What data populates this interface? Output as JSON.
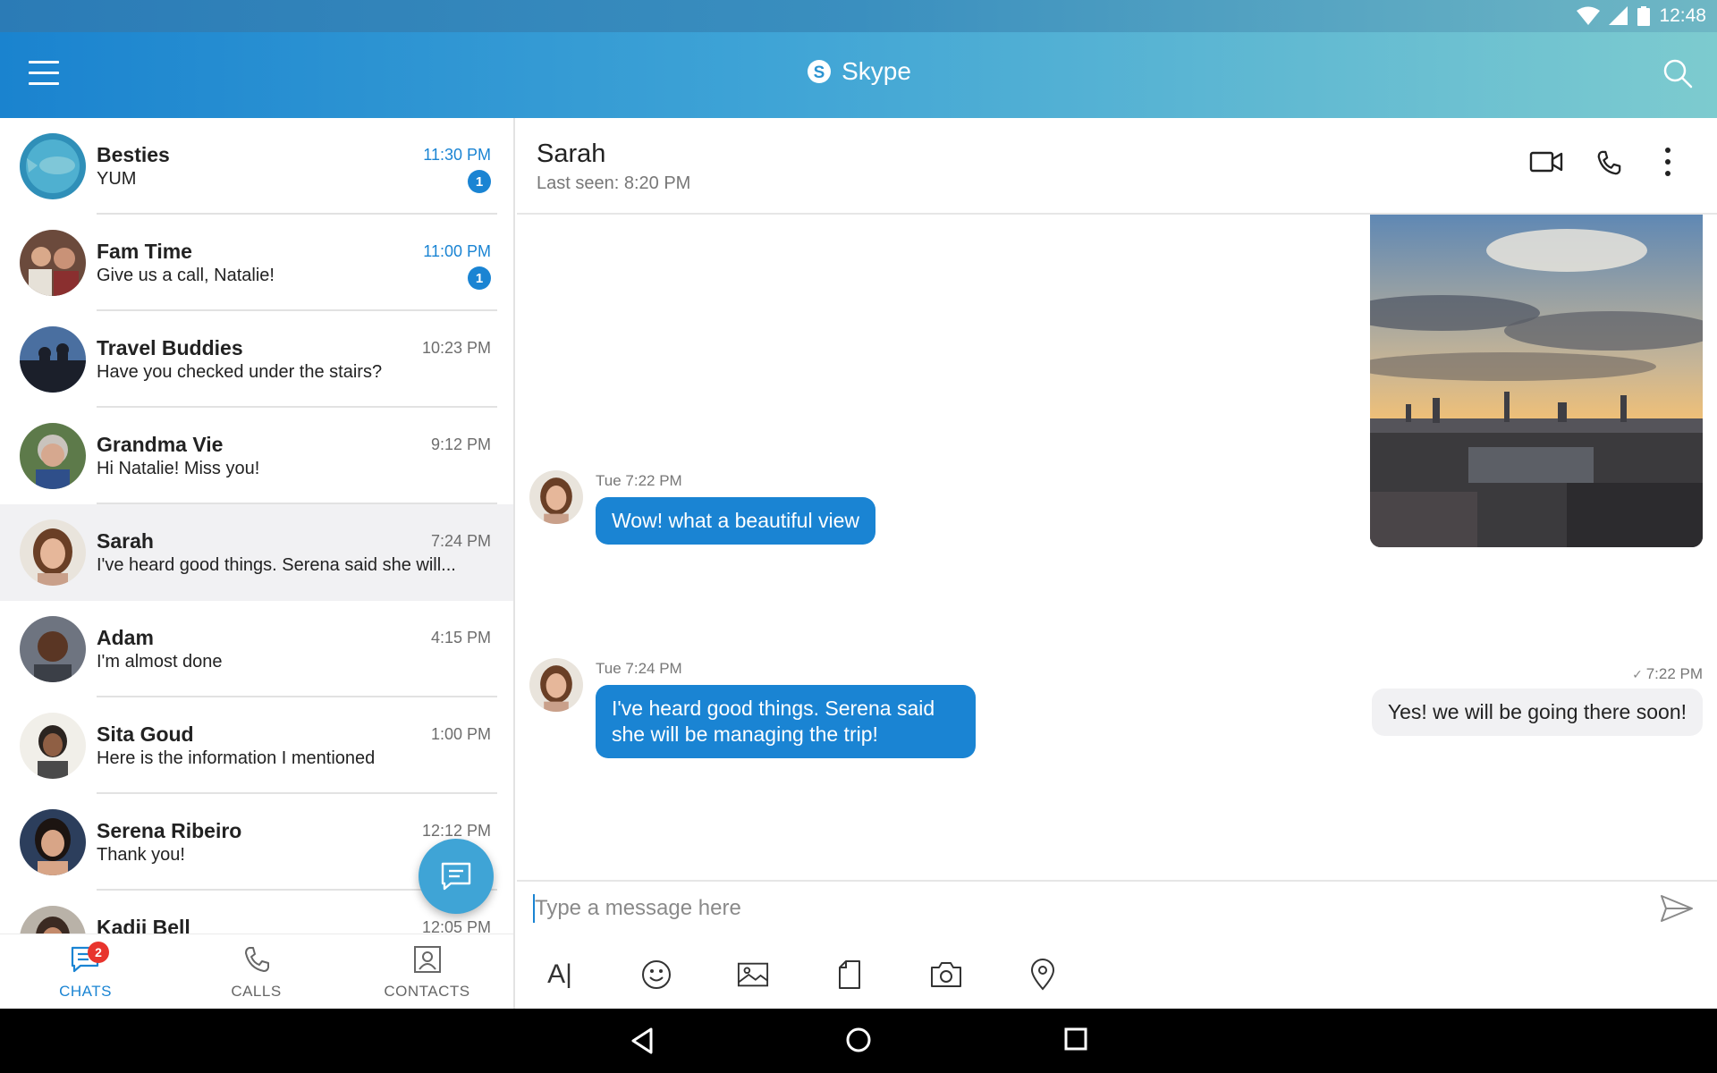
{
  "status_bar": {
    "time": "12:48"
  },
  "app_bar": {
    "title": "Skype"
  },
  "chats": [
    {
      "name": "Besties",
      "preview": "YUM",
      "time": "11:30 PM",
      "unread": "1"
    },
    {
      "name": "Fam Time",
      "preview": "Give us a call, Natalie!",
      "time": "11:00 PM",
      "unread": "1"
    },
    {
      "name": "Travel Buddies",
      "preview": "Have you checked under the stairs?",
      "time": "10:23 PM"
    },
    {
      "name": "Grandma Vie",
      "preview": "Hi Natalie! Miss you!",
      "time": "9:12 PM"
    },
    {
      "name": "Sarah",
      "preview": "I've heard good things. Serena said she will...",
      "time": "7:24 PM"
    },
    {
      "name": "Adam",
      "preview": "I'm almost done",
      "time": "4:15 PM"
    },
    {
      "name": "Sita Goud",
      "preview": "Here is the information I mentioned",
      "time": "1:00 PM"
    },
    {
      "name": "Serena Ribeiro",
      "preview": "Thank you!",
      "time": "12:12 PM"
    },
    {
      "name": "Kadii Bell",
      "preview": "",
      "time": "12:05 PM"
    }
  ],
  "bottom_nav": {
    "chats": "CHATS",
    "chats_badge": "2",
    "calls": "CALLS",
    "contacts": "CONTACTS"
  },
  "conversation": {
    "name": "Sarah",
    "last_seen": "Last seen: 8:20 PM",
    "messages": [
      {
        "time": "Tue 7:22 PM",
        "text": "Wow! what a beautiful view"
      },
      {
        "time": "7:22 PM",
        "text": "Yes! we will be going there soon!"
      },
      {
        "time": "Tue 7:24 PM",
        "text": "I've heard good things. Serena said she will be managing the trip!"
      }
    ]
  },
  "composer": {
    "placeholder": "Type a message here",
    "font_tool": "A|"
  },
  "colors": {
    "accent": "#1a84d3",
    "appbar_start": "#1a83cf",
    "appbar_end": "#7dcbcf",
    "outgoing_bubble": "#f1f1f3",
    "badge_red": "#e8342d"
  }
}
